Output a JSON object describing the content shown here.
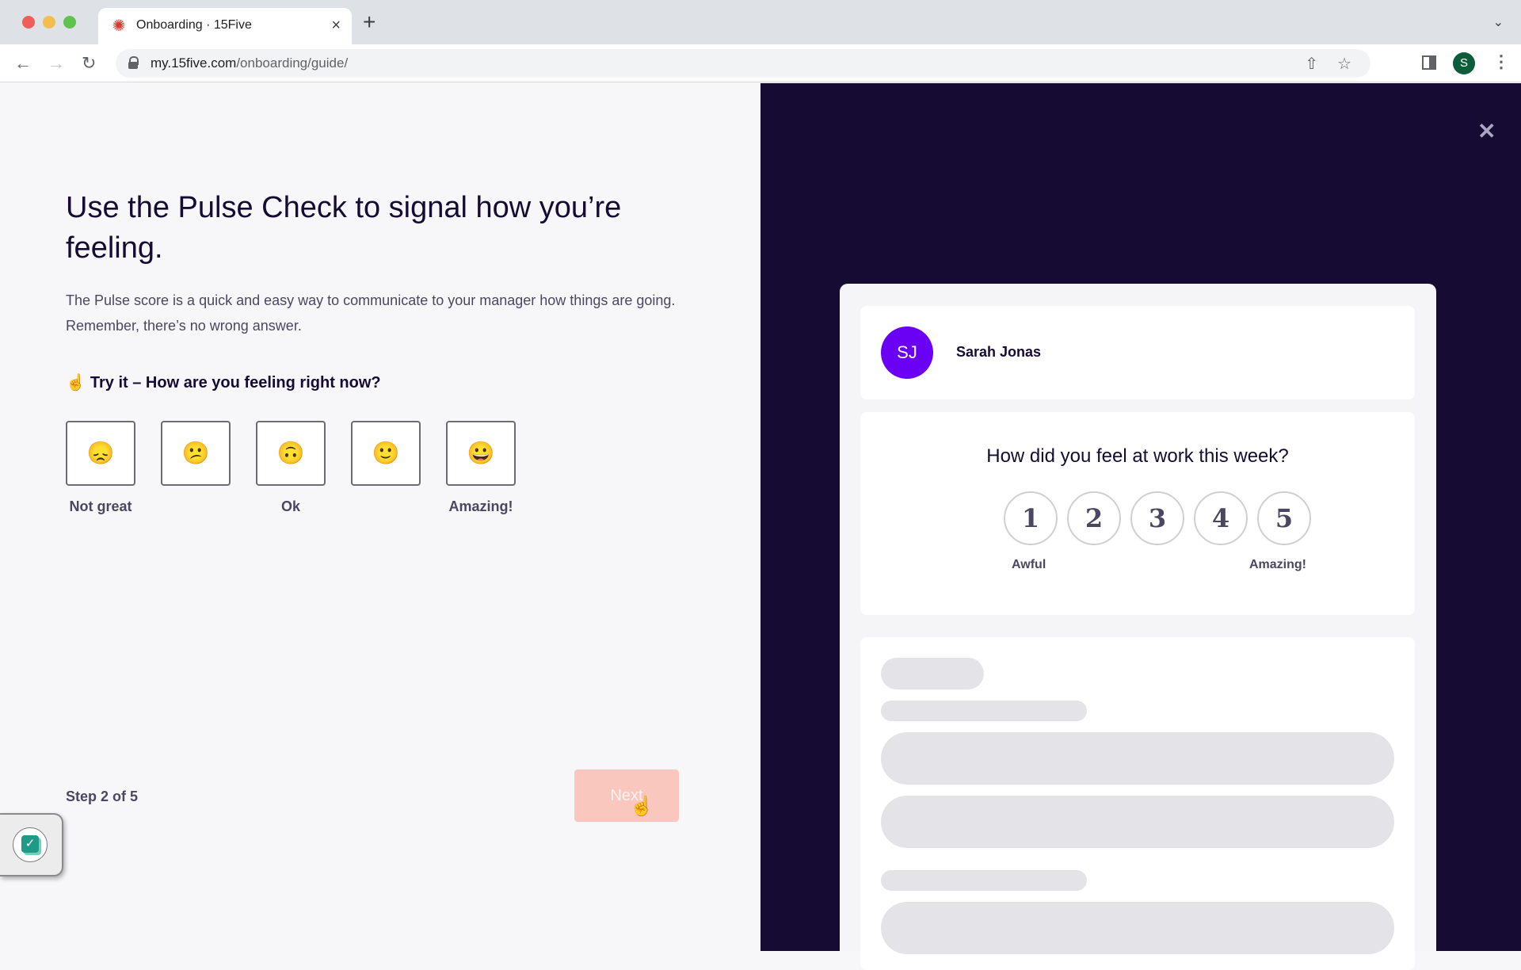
{
  "browser": {
    "tab_title": "Onboarding · 15Five",
    "tab_close": "×",
    "new_tab": "+",
    "tab_menu": "⌄",
    "url_domain": "my.15five.com",
    "url_path": "/onboarding/guide/",
    "profile_initial": "S",
    "icons": {
      "back": "←",
      "forward": "→",
      "reload": "↻",
      "share": "⇧",
      "star": "☆",
      "extensions": "✱",
      "menu": "⋮",
      "favicon": "✺"
    }
  },
  "guide": {
    "title": "Use the Pulse Check to signal how you’re feeling.",
    "description": "The Pulse score is a quick and easy way to communicate to your manager how things are going. Remember, there’s no wrong answer.",
    "try_icon": "☝️",
    "try_text": "Try it – How are you feeling right now?",
    "emoji_options": [
      {
        "emoji": "😞",
        "label": "Not great"
      },
      {
        "emoji": "😕",
        "label": ""
      },
      {
        "emoji": "🙃",
        "label": "Ok"
      },
      {
        "emoji": "🙂",
        "label": ""
      },
      {
        "emoji": "😀",
        "label": "Amazing!"
      }
    ],
    "step_text": "Step 2 of 5",
    "next_label": "Next"
  },
  "preview": {
    "close_icon": "✕",
    "user": {
      "initials": "SJ",
      "name": "Sarah Jonas",
      "avatar_color": "#6a00f4"
    },
    "question": "How did you feel at work this week?",
    "scores": [
      "1",
      "2",
      "3",
      "4",
      "5"
    ],
    "low_label": "Awful",
    "high_label": "Amazing!"
  },
  "colors": {
    "dark_bg": "#160b33",
    "next_button_disabled": "#f9c7bd",
    "accent_purple": "#6a00f4"
  },
  "widget": {
    "check_icon": "✓"
  }
}
